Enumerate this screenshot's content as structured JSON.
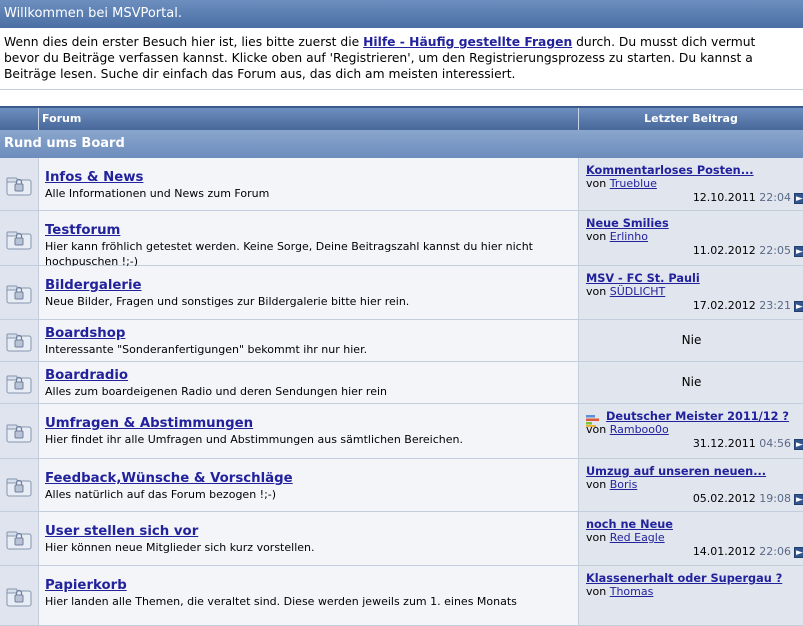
{
  "welcome": {
    "title": "Willkommen bei MSVPortal.",
    "line1_pre": "Wenn dies dein erster Besuch hier ist, lies bitte zuerst die ",
    "faq_link": "Hilfe - Häufig gestellte Fragen",
    "line1_post": " durch. Du musst dich vermut",
    "line2": "bevor du Beiträge verfassen kannst. Klicke oben auf 'Registrieren', um den Registrierungsprozess zu starten. Du kannst a",
    "line3": "Beiträge lesen. Suche dir einfach das Forum aus, das dich am meisten interessiert."
  },
  "table_header": {
    "forum": "Forum",
    "last_post": "Letzter Beitrag"
  },
  "category": {
    "name": "Rund ums Board"
  },
  "colors": {
    "link": "#22229c",
    "header": "#4a6ea4",
    "row_bg": "#f4f5f9",
    "lastpost_bg": "#e1e5ee"
  },
  "forums": [
    {
      "icon": "folder-lock-icon",
      "title": "Infos & News",
      "desc": "Alle Informationen und News zum Forum",
      "last": {
        "title": "Kommentarloses Posten...",
        "by": "von",
        "user": "Trueblue",
        "date": "12.10.2011",
        "time": "22:04"
      }
    },
    {
      "icon": "folder-lock-icon",
      "title": "Testforum",
      "desc": "Hier kann fröhlich getestet werden. Keine Sorge, Deine Beitragszahl kannst du hier nicht hochpuschen !;-)",
      "last": {
        "title": "Neue Smilies",
        "by": "von",
        "user": "Erlinho",
        "date": "11.02.2012",
        "time": "22:05"
      }
    },
    {
      "icon": "folder-lock-icon",
      "title": "Bildergalerie",
      "desc": "Neue Bilder, Fragen und sonstiges zur Bildergalerie bitte hier rein.",
      "last": {
        "title": "MSV - FC St. Pauli",
        "by": "von",
        "user": "SÜDLICHT",
        "date": "17.02.2012",
        "time": "23:21"
      }
    },
    {
      "icon": "folder-lock-icon",
      "title": "Boardshop",
      "desc": "Interessante \"Sonderanfertigungen\" bekommt ihr nur hier.",
      "last": {
        "none": "Nie"
      }
    },
    {
      "icon": "folder-lock-icon",
      "title": "Boardradio",
      "desc": "Alles zum boardeigenen Radio und deren Sendungen hier rein",
      "last": {
        "none": "Nie"
      }
    },
    {
      "icon": "folder-lock-icon",
      "title": "Umfragen & Abstimmungen",
      "desc": "Hier findet ihr alle Umfragen und Abstimmungen aus sämtlichen Bereichen.",
      "last": {
        "title": "Deutscher Meister 2011/12 ?",
        "by": "von",
        "user": "Ramboo0o",
        "date": "31.12.2011",
        "time": "04:56",
        "poll": true
      }
    },
    {
      "icon": "folder-lock-icon",
      "title": "Feedback,Wünsche & Vorschläge",
      "desc": "Alles natürlich auf das Forum bezogen !;-)",
      "last": {
        "title": "Umzug auf unseren neuen...",
        "by": "von",
        "user": "Boris",
        "date": "05.02.2012",
        "time": "19:08"
      }
    },
    {
      "icon": "folder-lock-icon",
      "title": "User stellen sich vor",
      "desc": "Hier können neue Mitglieder sich kurz vorstellen.",
      "last": {
        "title": "noch ne Neue",
        "by": "von",
        "user": "Red Eagle",
        "date": "14.01.2012",
        "time": "22:06"
      }
    },
    {
      "icon": "folder-lock-icon",
      "title": "Papierkorb",
      "desc": "Hier landen alle Themen, die veraltet sind. Diese werden jeweils zum 1. eines Monats",
      "last": {
        "title": "Klassenerhalt oder Supergau ?",
        "by": "von",
        "user": "Thomas"
      }
    }
  ]
}
